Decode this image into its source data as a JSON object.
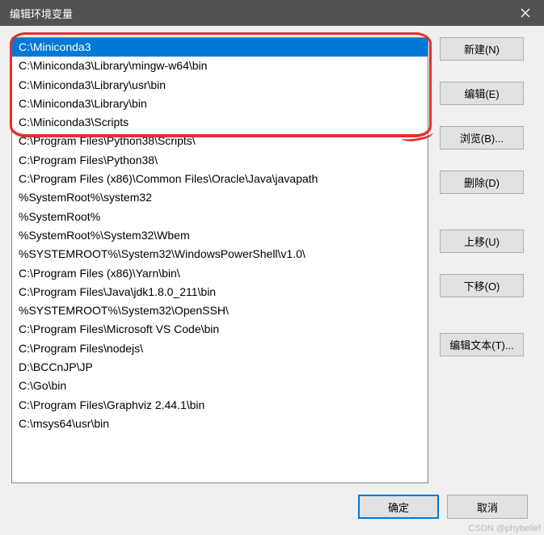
{
  "titlebar": {
    "title": "编辑环境变量"
  },
  "list": {
    "selected_index": 0,
    "items": [
      "C:\\Miniconda3",
      "C:\\Miniconda3\\Library\\mingw-w64\\bin",
      "C:\\Miniconda3\\Library\\usr\\bin",
      "C:\\Miniconda3\\Library\\bin",
      "C:\\Miniconda3\\Scripts",
      "C:\\Program Files\\Python38\\Scripts\\",
      "C:\\Program Files\\Python38\\",
      "C:\\Program Files (x86)\\Common Files\\Oracle\\Java\\javapath",
      "%SystemRoot%\\system32",
      "%SystemRoot%",
      "%SystemRoot%\\System32\\Wbem",
      "%SYSTEMROOT%\\System32\\WindowsPowerShell\\v1.0\\",
      "C:\\Program Files (x86)\\Yarn\\bin\\",
      "C:\\Program Files\\Java\\jdk1.8.0_211\\bin",
      "%SYSTEMROOT%\\System32\\OpenSSH\\",
      "C:\\Program Files\\Microsoft VS Code\\bin",
      "C:\\Program Files\\nodejs\\",
      "D:\\BCCnJP\\JP",
      "C:\\Go\\bin",
      "C:\\Program Files\\Graphviz 2.44.1\\bin",
      "C:\\msys64\\usr\\bin"
    ]
  },
  "buttons": {
    "new": "新建(N)",
    "edit": "编辑(E)",
    "browse": "浏览(B)...",
    "delete": "删除(D)",
    "move_up": "上移(U)",
    "move_down": "下移(O)",
    "edit_text": "编辑文本(T)...",
    "ok": "确定",
    "cancel": "取消"
  },
  "watermark": "CSDN @phybelief"
}
